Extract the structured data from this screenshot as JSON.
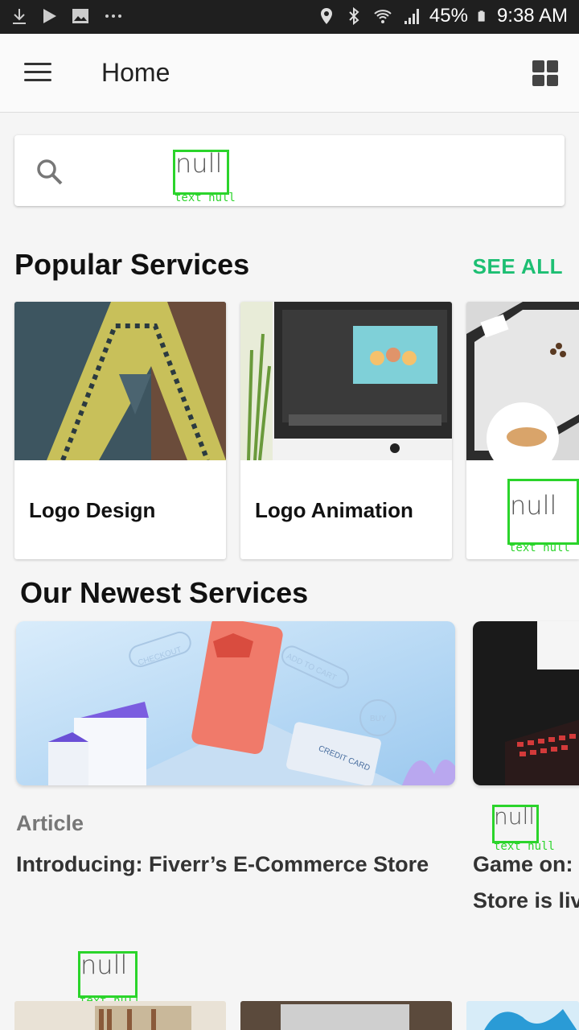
{
  "status_bar": {
    "battery": "45%",
    "time": "9:38 AM",
    "icons": [
      "download-icon",
      "play-store-icon",
      "image-icon",
      "more-dots-icon",
      "location-icon",
      "bluetooth-icon",
      "wifi-icon",
      "signal-icon",
      "battery-icon"
    ]
  },
  "appbar": {
    "title": "Home",
    "menu_icon": "hamburger-menu-icon",
    "grid_icon": "grid-view-icon"
  },
  "search": {
    "icon": "search-icon",
    "value": "null",
    "annotation": "text null"
  },
  "popular": {
    "title": "Popular Services",
    "see_all": "SEE ALL",
    "cards": [
      {
        "label": "Logo Design"
      },
      {
        "label": "Logo Animation"
      },
      {
        "label": "null",
        "annotation": "text null"
      }
    ]
  },
  "newest": {
    "title": "Our Newest Services",
    "items": [
      {
        "kicker": "Article",
        "headline": "Introducing: Fiverr’s E-Commerce Store",
        "image_text": [
          "CHECKOUT",
          "ADD TO CART",
          "BUY",
          "CREDIT CARD"
        ]
      },
      {
        "kicker": "null",
        "kicker_annotation": "text null",
        "headline_line1": "Game on:",
        "headline_line2": "Store is liv"
      }
    ]
  },
  "bottom": {
    "label": "null",
    "annotation": "text null"
  },
  "colors": {
    "accent": "#1dbf73",
    "annotation_box": "#2bd42b",
    "status_bar": "#1f1f1f"
  }
}
